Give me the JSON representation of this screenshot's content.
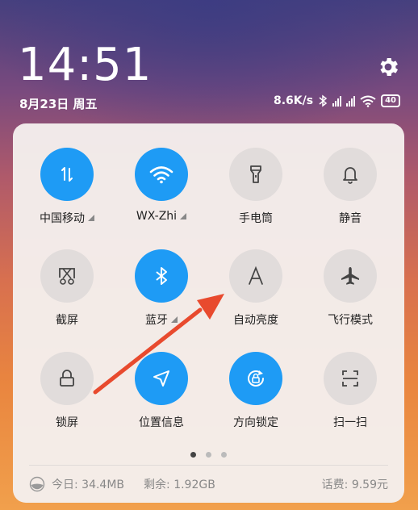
{
  "header": {
    "time": "14:51",
    "date": "8月23日 周五",
    "network_speed": "8.6K/s",
    "battery": "40"
  },
  "tiles": [
    {
      "label": "中国移动",
      "state": "on",
      "icon": "data-transfer-icon",
      "has_more": true
    },
    {
      "label": "WX-Zhi",
      "state": "on",
      "icon": "wifi-icon",
      "has_more": true
    },
    {
      "label": "手电筒",
      "state": "off",
      "icon": "flashlight-icon",
      "has_more": false
    },
    {
      "label": "静音",
      "state": "off",
      "icon": "bell-icon",
      "has_more": false
    },
    {
      "label": "截屏",
      "state": "off",
      "icon": "screenshot-icon",
      "has_more": false
    },
    {
      "label": "蓝牙",
      "state": "on",
      "icon": "bluetooth-icon",
      "has_more": true
    },
    {
      "label": "自动亮度",
      "state": "off",
      "icon": "auto-brightness-icon",
      "has_more": false
    },
    {
      "label": "飞行模式",
      "state": "off",
      "icon": "airplane-icon",
      "has_more": false
    },
    {
      "label": "锁屏",
      "state": "off",
      "icon": "lock-icon",
      "has_more": false
    },
    {
      "label": "位置信息",
      "state": "on",
      "icon": "location-icon",
      "has_more": false
    },
    {
      "label": "方向锁定",
      "state": "on",
      "icon": "rotation-lock-icon",
      "has_more": false
    },
    {
      "label": "扫一扫",
      "state": "off",
      "icon": "scan-icon",
      "has_more": false
    }
  ],
  "pager": {
    "pages": 3,
    "active": 1
  },
  "footer": {
    "today": "今日: 34.4MB",
    "remaining": "剩余: 1.92GB",
    "balance": "话费: 9.59元"
  },
  "colors": {
    "accent": "#1e9bf5",
    "annotation_arrow": "#e84a2e"
  }
}
